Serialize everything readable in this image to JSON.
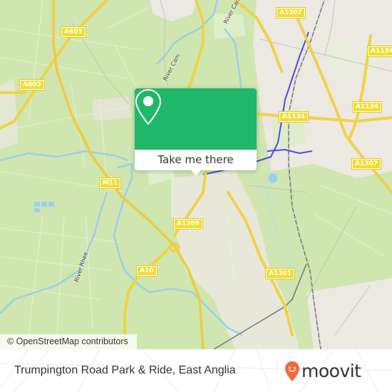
{
  "map": {
    "road_labels": [
      {
        "id": "a603-top",
        "text": "A603"
      },
      {
        "id": "a603-left",
        "text": "A603"
      },
      {
        "id": "a1307-top",
        "text": "A1307"
      },
      {
        "id": "a1134-right",
        "text": "A1134"
      },
      {
        "id": "a1134-center",
        "text": "A1134"
      },
      {
        "id": "a1134-far-right",
        "text": "A1134"
      },
      {
        "id": "a1307-right",
        "text": "A1307"
      },
      {
        "id": "m11",
        "text": "M11"
      },
      {
        "id": "a1309",
        "text": "A1309"
      },
      {
        "id": "a10",
        "text": "A10"
      },
      {
        "id": "a1301",
        "text": "A1301"
      }
    ],
    "river_labels": [
      {
        "id": "river-cam-1",
        "text": "River Cam"
      },
      {
        "id": "river-cam-2",
        "text": "River Cam"
      },
      {
        "id": "river-rhee",
        "text": "River Rhee"
      }
    ],
    "attribution": "© OpenStreetMap contributors"
  },
  "popup": {
    "button_label": "Take me there",
    "icon": "map-pin-icon",
    "color": "#1fb76a"
  },
  "footer": {
    "title": "Trumpington Road Park & Ride, East Anglia",
    "logo_text": "moovit",
    "logo_color": "#f26b3a"
  }
}
